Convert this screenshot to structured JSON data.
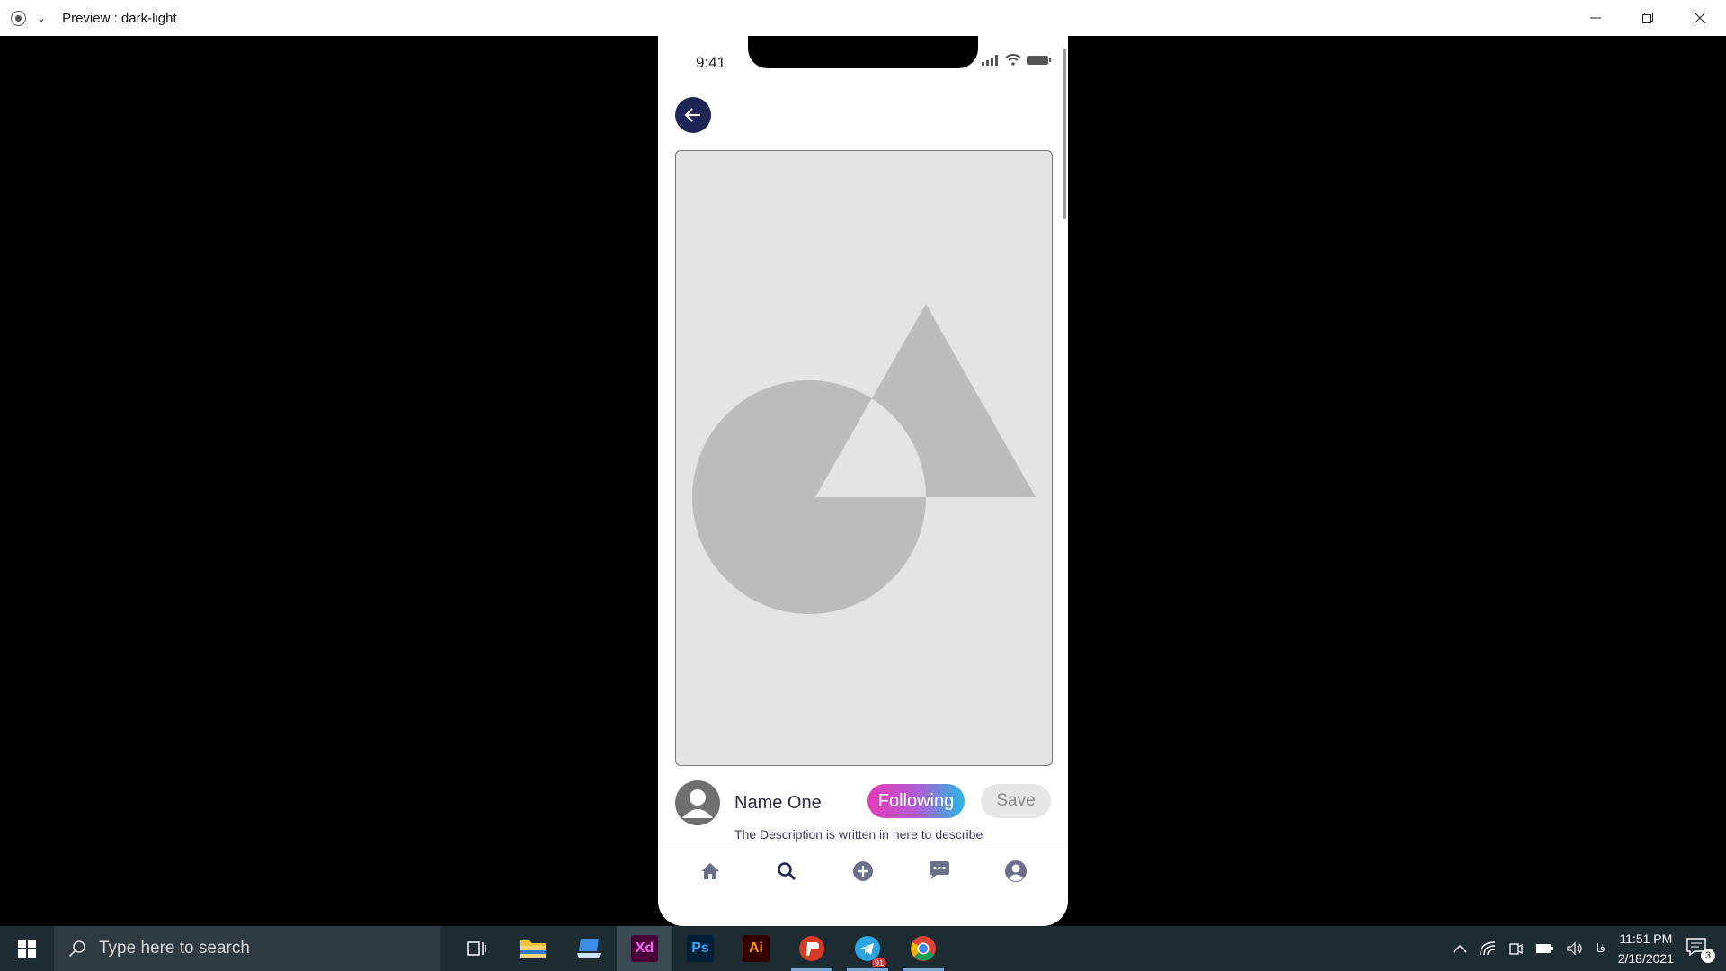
{
  "window": {
    "title": "Preview : dark-light"
  },
  "phone": {
    "status_time": "9:41",
    "profile": {
      "name": "Name One",
      "following_label": "Following",
      "save_label": "Save"
    },
    "description": "The Description is written in here to describe",
    "nav": [
      "home-icon",
      "search-icon",
      "add-icon",
      "chat-icon",
      "profile-icon"
    ]
  },
  "taskbar": {
    "search_placeholder": "Type here to search",
    "apps": [
      "task-view",
      "file-explorer",
      "app",
      "Xd",
      "Ps",
      "Ai",
      "psiphon",
      "telegram",
      "chrome"
    ],
    "telegram_badge": "91",
    "xd_label": "Xd",
    "ps_label": "Ps",
    "ai_label": "Ai",
    "lang": "فا",
    "time": "11:51 PM",
    "date": "2/18/2021",
    "notifications": "3"
  },
  "colors": {
    "back_button": "#1f2556",
    "follow_gradient_start": "#e63bb8",
    "follow_gradient_end": "#28b8e6",
    "placeholder_bg": "#e4e4e4",
    "placeholder_shape": "#bcbcbc"
  }
}
